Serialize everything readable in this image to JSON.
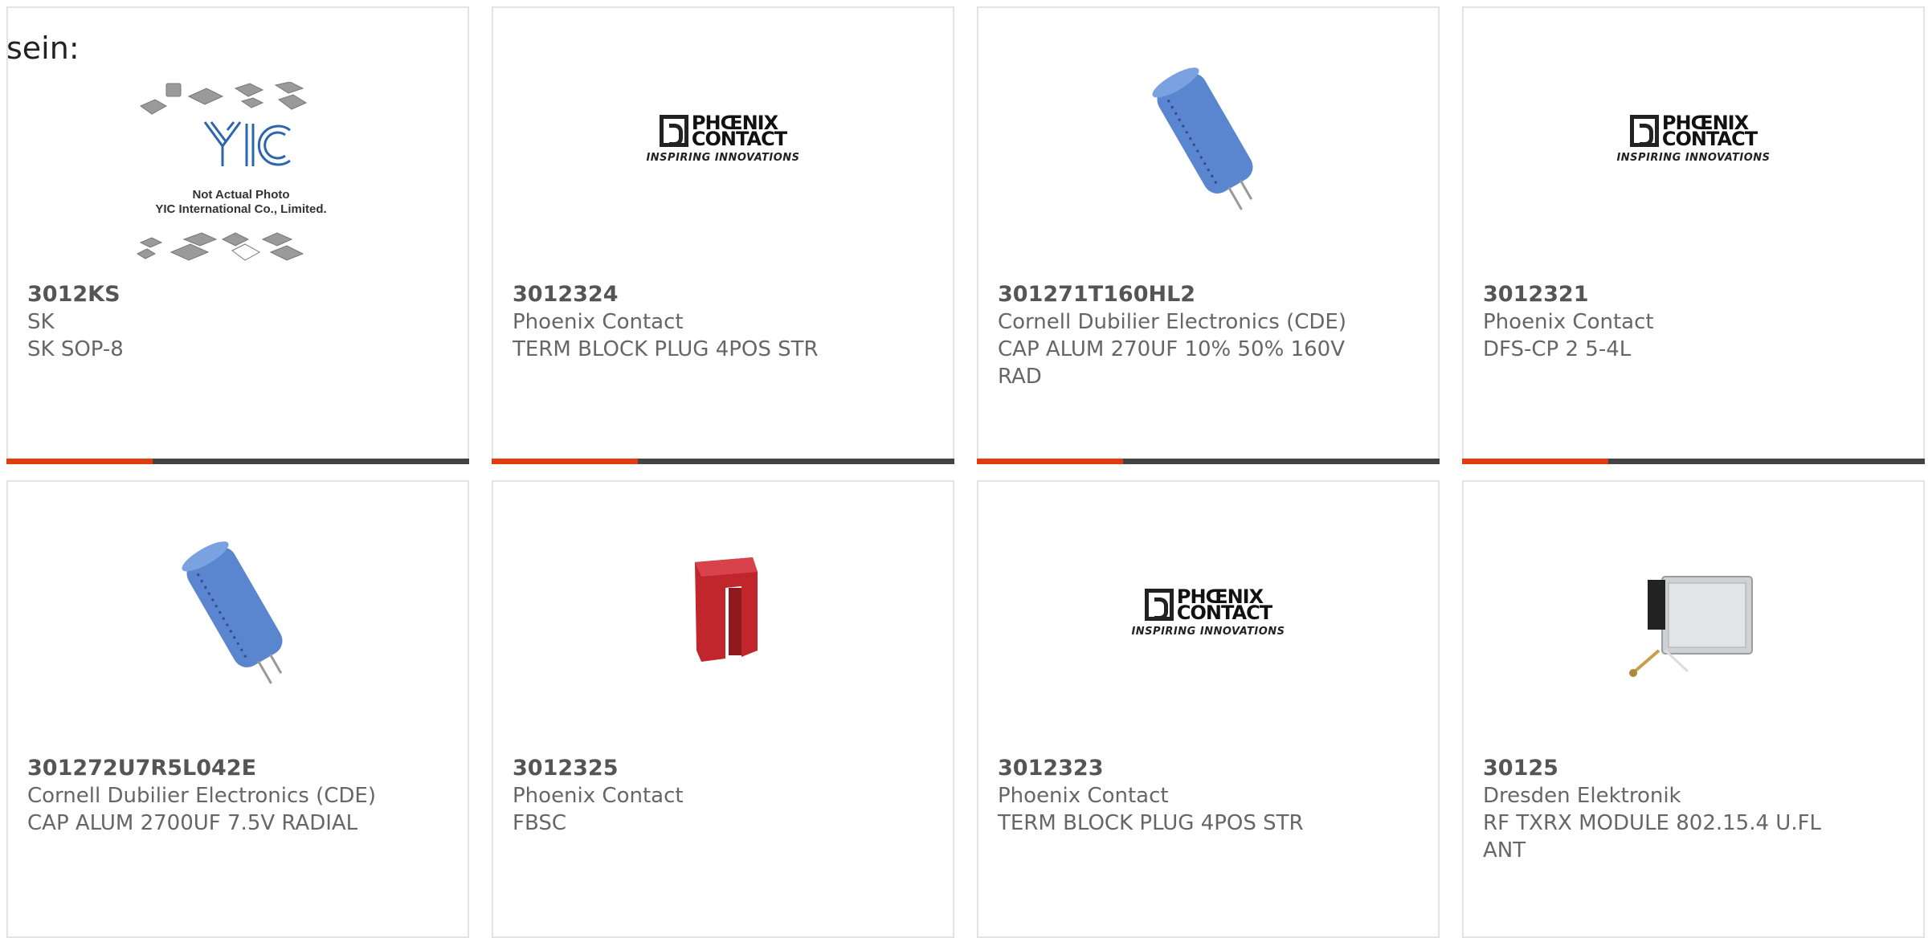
{
  "intro_text": "sein:",
  "colors": {
    "accent": "#e03c10",
    "bar": "#444444",
    "border": "#e3e3e3"
  },
  "products": [
    {
      "part": "3012KS",
      "manufacturer": "SK",
      "description": "SK SOP-8",
      "image": "yic-placeholder-photo",
      "image_note_line1": "Not Actual Photo",
      "image_note_line2": "YIC International Co., Limited.",
      "image_logo": "YIC"
    },
    {
      "part": "3012324",
      "manufacturer": "Phoenix Contact",
      "description": "TERM BLOCK PLUG 4POS STR",
      "image": "phoenix-contact-logo"
    },
    {
      "part": "301271T160HL2",
      "manufacturer": "Cornell Dubilier Electronics (CDE)",
      "description": "CAP ALUM 270UF 10% 50% 160V RAD",
      "image": "blue-capacitor"
    },
    {
      "part": "3012321",
      "manufacturer": "Phoenix Contact",
      "description": "DFS-CP 2 5-4L",
      "image": "phoenix-contact-logo"
    },
    {
      "part": "301272U7R5L042E",
      "manufacturer": "Cornell Dubilier Electronics (CDE)",
      "description": "CAP ALUM 2700UF 7.5V RADIAL",
      "image": "blue-capacitor"
    },
    {
      "part": "3012325",
      "manufacturer": "Phoenix Contact",
      "description": "FBSC",
      "image": "red-bridge-connector"
    },
    {
      "part": "3012323",
      "manufacturer": "Phoenix Contact",
      "description": "TERM BLOCK PLUG 4POS STR",
      "image": "phoenix-contact-logo"
    },
    {
      "part": "30125",
      "manufacturer": "Dresden Elektronik",
      "description": "RF TXRX MODULE 802.15.4 U.FL ANT",
      "image": "rf-module"
    }
  ],
  "phoenix_logo": {
    "line1": "PHŒNIX",
    "line2": "CONTACT",
    "tagline": "INSPIRING INNOVATIONS"
  }
}
